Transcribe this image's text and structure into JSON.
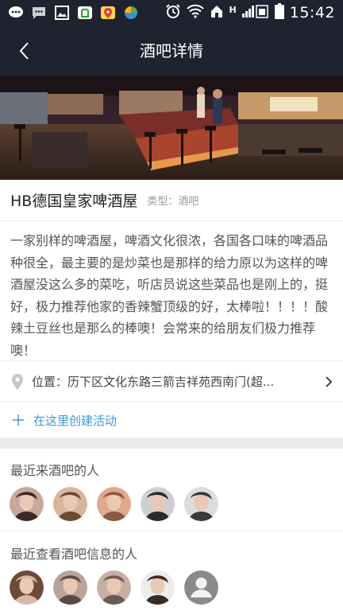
{
  "status_bar": {
    "time": "15:42",
    "network_label": "H",
    "left_icons": [
      "chat-icon",
      "message-icon",
      "gallery-icon",
      "shopping-icon",
      "maps-icon",
      "browser-icon"
    ],
    "right_icons": [
      "alarm-icon",
      "wifi-icon",
      "home-icon",
      "signal-icon",
      "battery-icon"
    ]
  },
  "nav": {
    "title": "酒吧详情"
  },
  "bar": {
    "name": "HB德国皇家啤酒屋",
    "type": "类型：酒吧",
    "description": "一家别样的啤酒屋，啤酒文化很浓，各国各口味的啤酒品种很全，最主要的是炒菜也是那样的给力原以为这样的啤酒屋没这么多的菜吃，听店员说这些菜品也是刚上的，挺好，极力推荐他家的香辣蟹顶级的好，太棒啦！！！！酸辣土豆丝也是那么的棒噢！会常来的给朋友们极力推荐噢！",
    "location": "位置：历下区文化东路三箭吉祥苑西南门(超..."
  },
  "create_activity": {
    "label": "在这里创建活动"
  },
  "recent_visitors": {
    "title": "最近来酒吧的人",
    "avatars": [
      {
        "colors": [
          "#c9a79b",
          "#3b2a26"
        ]
      },
      {
        "colors": [
          "#d9b59a",
          "#6b4a33"
        ]
      },
      {
        "colors": [
          "#e2a88c",
          "#8a5a45"
        ]
      },
      {
        "colors": [
          "#cfcfcf",
          "#2a2a2a"
        ]
      },
      {
        "colors": [
          "#dcdcdc",
          "#3a3a3a"
        ]
      }
    ]
  },
  "recent_viewers": {
    "title": "最近查看酒吧信息的人",
    "avatars": [
      {
        "colors": [
          "#6b4a3a",
          "#d9b8a5"
        ]
      },
      {
        "colors": [
          "#b8a59a",
          "#5a4a44"
        ]
      },
      {
        "colors": [
          "#c7b0a3",
          "#6e5a52"
        ]
      },
      {
        "colors": [
          "#ededed",
          "#3a2a26"
        ]
      },
      {
        "colors": [
          "#8a8a8a",
          "#f2f2f2"
        ],
        "placeholder": true
      }
    ]
  },
  "colors": {
    "header_bg": "#1f2330",
    "accent_blue": "#3a9bdc",
    "section_gap": "#ebebef"
  }
}
